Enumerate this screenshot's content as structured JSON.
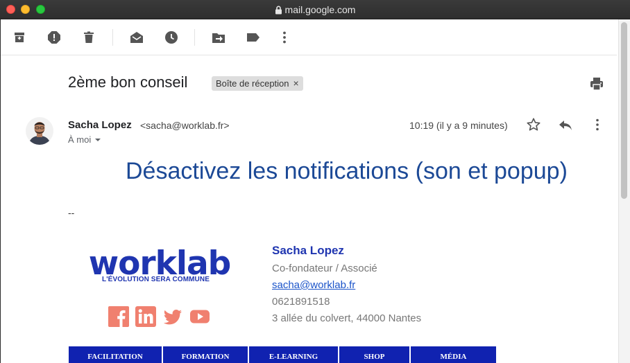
{
  "window": {
    "url": "mail.google.com"
  },
  "toolbar": {
    "icons": [
      "archive-icon",
      "report-spam-icon",
      "delete-icon",
      "mark-unread-icon",
      "snooze-icon",
      "move-to-icon",
      "label-icon",
      "more-icon"
    ]
  },
  "email": {
    "subject": "2ème bon conseil",
    "label": "Boîte de réception",
    "label_remove": "×",
    "sender_name": "Sacha Lopez",
    "sender_email": "<sacha@worklab.fr>",
    "to": "À moi",
    "timestamp": "10:19 (il y a 9 minutes)",
    "headline": "Désactivez les notifications (son et popup)",
    "sig_separator": "--"
  },
  "signature": {
    "logo_text": "worklab",
    "tagline": "L'ÉVOLUTION SERA COMMUNE",
    "name": "Sacha Lopez",
    "title": "Co-fondateur / Associé",
    "email": "sacha@worklab.fr",
    "phone": "0621891518",
    "address": "3 allée du colvert, 44000 Nantes",
    "social_color": "#f0806f",
    "brand_color": "#1f35b0",
    "nav": [
      "FACILITATION",
      "FORMATION",
      "E-LEARNING",
      "SHOP",
      "MÉDIA"
    ]
  }
}
